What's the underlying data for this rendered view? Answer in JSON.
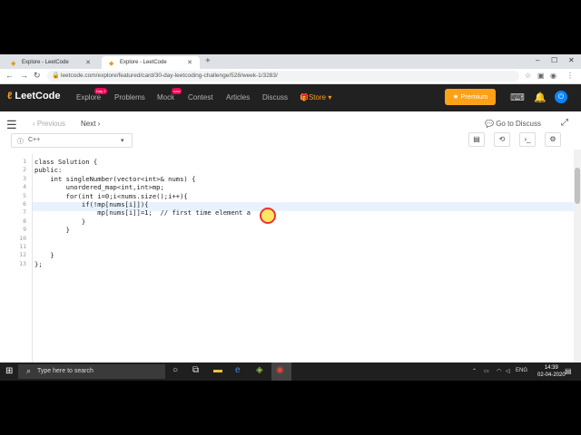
{
  "browser": {
    "tabs": [
      {
        "title": "Explore - LeetCode",
        "active": false
      },
      {
        "title": "Explore - LeetCode",
        "active": true
      }
    ],
    "new_tab_icon": "plus-icon",
    "url": "leetcode.com/explore/featured/card/30-day-leetcoding-challenge/528/week-1/3283/"
  },
  "header": {
    "logo": "LeetCode",
    "nav": [
      {
        "label": "Explore",
        "badge": "Day 2"
      },
      {
        "label": "Problems"
      },
      {
        "label": "Mock",
        "badge": "new"
      },
      {
        "label": "Contest"
      },
      {
        "label": "Articles"
      },
      {
        "label": "Discuss"
      },
      {
        "label": "Store"
      }
    ],
    "premium": "Premium",
    "accent": "#ffa116"
  },
  "subbar": {
    "previous": "Previous",
    "next": "Next",
    "go_to_discuss": "Go to Discuss"
  },
  "editor": {
    "language": "C++",
    "line_numbers": [
      "1",
      "2",
      "3",
      "4",
      "5",
      "6",
      "7",
      "8",
      "9",
      "10",
      "11",
      "12",
      "13"
    ],
    "lines": [
      "class Solution {",
      "public:",
      "    int singleNumber(vector<int>& nums) {",
      "        unordered_map<int,int>mp;",
      "        for(int i=0;i<nums.size();i++){",
      "            if(!mp[nums[i]]){",
      "                mp[nums[i]]=1;  // first time element a",
      "            }",
      "        }",
      "",
      "",
      "    }",
      "};"
    ]
  },
  "taskbar": {
    "search_placeholder": "Type here to search",
    "language": "ENG",
    "time": "14:39",
    "date": "02-04-2020"
  }
}
